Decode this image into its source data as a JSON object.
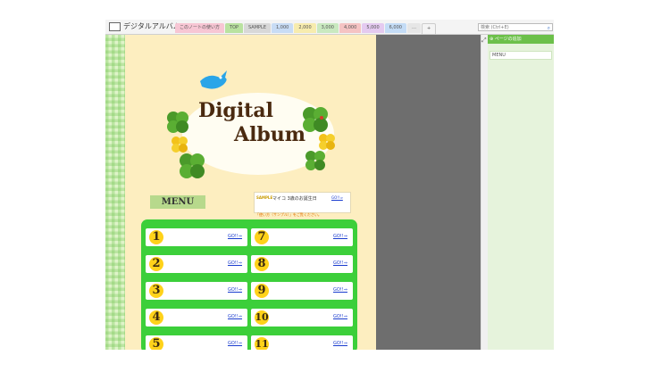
{
  "notebook": {
    "title": "デジタルアルバム",
    "icon": "notebook-icon"
  },
  "tabs": [
    {
      "label": "このノートの使い方",
      "color": "#f7c6d4"
    },
    {
      "label": "TOP",
      "color": "#b9e2a0"
    },
    {
      "label": "SAMPLE",
      "color": "#d8d8d8"
    },
    {
      "label": "1,000",
      "color": "#c8dcf5"
    },
    {
      "label": "2,000",
      "color": "#f7ecae"
    },
    {
      "label": "3,000",
      "color": "#c9e9c0"
    },
    {
      "label": "4,000",
      "color": "#f5c3c3"
    },
    {
      "label": "5,000",
      "color": "#e4caf0"
    },
    {
      "label": "6,000",
      "color": "#c4dcf6"
    },
    {
      "label": "…",
      "color": "#e6e6e6"
    },
    {
      "label": "+",
      "color": "#f4f4f4"
    }
  ],
  "search": {
    "placeholder": "検索 (Ctrl+E)",
    "icon": "search-icon"
  },
  "page": {
    "logo_line1": "Digital",
    "logo_line2": "Album",
    "menu_label": "MENU",
    "sample": {
      "badge": "SAMPLE",
      "text": "マイコ 3歳のお誕生日",
      "go": "GO!!⇒"
    },
    "sample_note": "「使い方（サンプル）」をご覧ください。",
    "cells": [
      {
        "num": "1",
        "go": "GO!!⇒"
      },
      {
        "num": "7",
        "go": "GO!!⇒"
      },
      {
        "num": "2",
        "go": "GO!!⇒"
      },
      {
        "num": "8",
        "go": "GO!!⇒"
      },
      {
        "num": "3",
        "go": "GO!!⇒"
      },
      {
        "num": "9",
        "go": "GO!!⇒"
      },
      {
        "num": "4",
        "go": "GO!!⇒"
      },
      {
        "num": "10",
        "go": "GO!!⇒"
      },
      {
        "num": "5",
        "go": "GO!!⇒"
      },
      {
        "num": "11",
        "go": "GO!!⇒"
      }
    ]
  },
  "right_panel": {
    "header": "ページの追加",
    "item": "MENU"
  },
  "colors": {
    "green_accent": "#3ccf3a",
    "page_bg": "#fdeec0",
    "link": "#1a3ccf"
  }
}
